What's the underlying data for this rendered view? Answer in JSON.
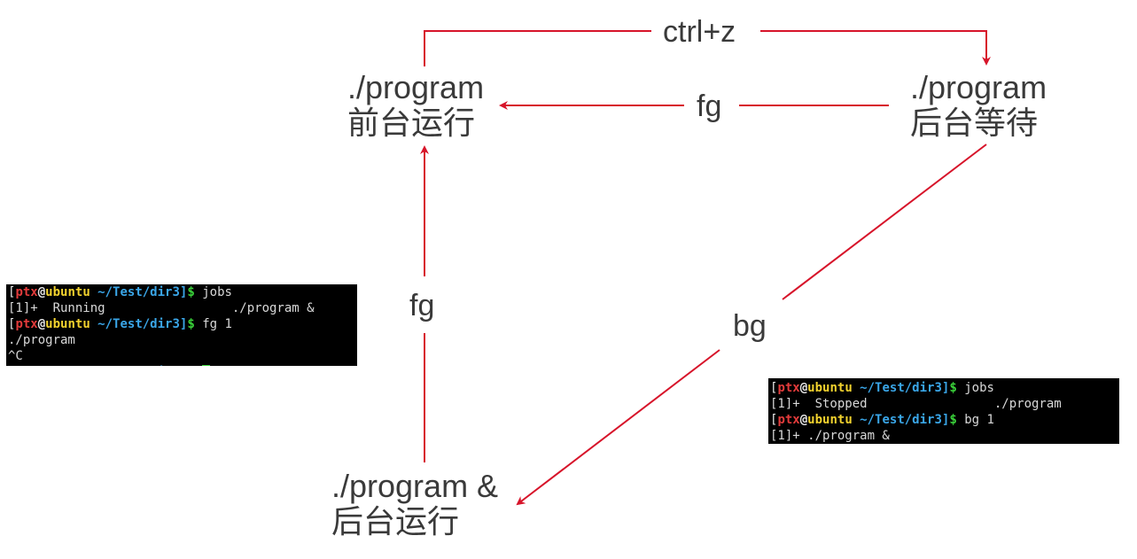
{
  "colors": {
    "arrow": "#d7142a",
    "text": "#3a3a3a",
    "terminal_bg": "#000000"
  },
  "nodes": {
    "foreground": {
      "cmd": "./program",
      "desc": "前台运行"
    },
    "background_wait": {
      "cmd": "./program",
      "desc": "后台等待"
    },
    "background_run": {
      "cmd": "./program &",
      "desc": "后台运行"
    }
  },
  "edges": {
    "ctrl_z": "ctrl+z",
    "fg_top": "fg",
    "fg_left": "fg",
    "bg": "bg"
  },
  "terminal1": {
    "prompt": {
      "open": "[",
      "user": "ptx",
      "at": "@",
      "host": "ubuntu",
      "path": " ~/Test/dir3",
      "close": "]",
      "dollar": "$"
    },
    "cmd1": " jobs",
    "out1": "[1]+  Running                 ./program &",
    "cmd2": " fg 1",
    "out2": "./program",
    "out3": "^C"
  },
  "terminal2": {
    "prompt": {
      "open": "[",
      "user": "ptx",
      "at": "@",
      "host": "ubuntu",
      "path": " ~/Test/dir3",
      "close": "]",
      "dollar": "$"
    },
    "cmd1": " jobs",
    "out1": "[1]+  Stopped                 ./program",
    "cmd2": " bg 1",
    "out2": "[1]+ ./program &"
  }
}
